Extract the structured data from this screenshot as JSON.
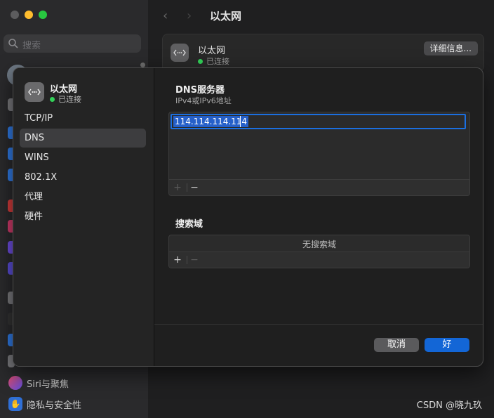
{
  "background": {
    "search_placeholder": "搜索",
    "page_title": "以太网",
    "nav_back": "‹",
    "nav_forward": "›",
    "card": {
      "name": "以太网",
      "status": "已连接",
      "details_button": "详细信息..."
    },
    "sidebar_bottom": [
      {
        "label": "Siri与聚焦",
        "icon": "siri-icon"
      },
      {
        "label": "隐私与安全性",
        "icon": "privacy-hand-icon"
      }
    ]
  },
  "sheet": {
    "header": {
      "name": "以太网",
      "status": "已连接"
    },
    "nav": [
      {
        "label": "TCP/IP",
        "active": false
      },
      {
        "label": "DNS",
        "active": true
      },
      {
        "label": "WINS",
        "active": false
      },
      {
        "label": "802.1X",
        "active": false
      },
      {
        "label": "代理",
        "active": false
      },
      {
        "label": "硬件",
        "active": false
      }
    ],
    "dns": {
      "title": "DNS服务器",
      "subtitle": "IPv4或IPv6地址",
      "entries": [
        "114.114.114.114"
      ],
      "add": "+",
      "remove": "−"
    },
    "search_domains": {
      "title": "搜索域",
      "empty_text": "无搜索域",
      "add": "+",
      "remove": "−"
    },
    "buttons": {
      "cancel": "取消",
      "ok": "好"
    }
  },
  "watermark": "CSDN @晓九玖",
  "colors": {
    "accent": "#1366d6",
    "status_green": "#32d158"
  }
}
